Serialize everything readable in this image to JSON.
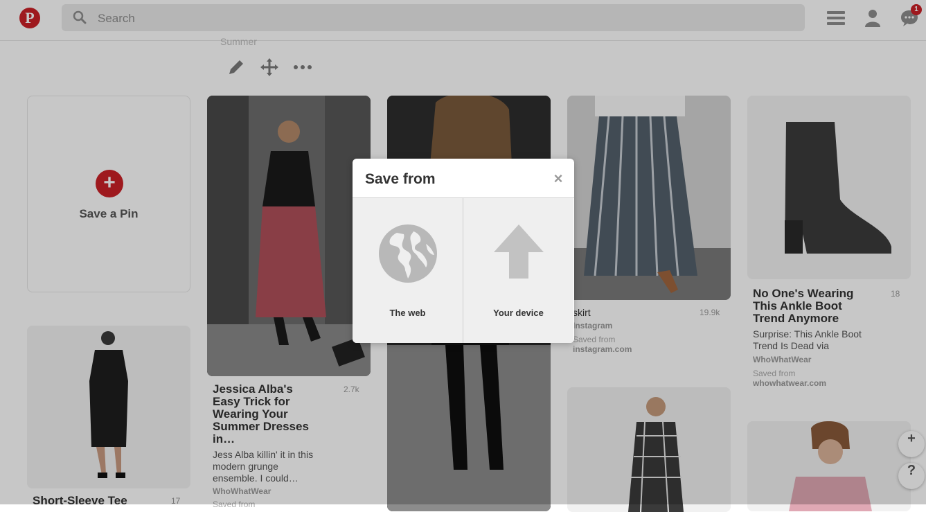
{
  "header": {
    "logo_letter": "P",
    "search_placeholder": "Search",
    "notification_count": "1"
  },
  "board": {
    "title": "Summer"
  },
  "save_pin": {
    "label": "Save a Pin"
  },
  "pins": [
    {
      "title": "Jessica Alba's Easy Trick for Wearing Your Summer Dresses in…",
      "description": "Jess Alba killin' it in this modern grunge ensemble. I could…",
      "source": "WhoWhatWear",
      "saved_prefix": "Saved from",
      "count": "2.7k"
    },
    {
      "title": "skirt",
      "source": "Instagram",
      "saved_prefix": "Saved from",
      "saved_domain": "instagram.com",
      "count": "19.9k"
    },
    {
      "title": "No One's Wearing This Ankle Boot Trend Anymore",
      "description": "Surprise: This Ankle Boot Trend Is Dead via",
      "source": "WhoWhatWear",
      "saved_prefix": "Saved from",
      "saved_domain": "whowhatwear.com",
      "count": "18"
    },
    {
      "title": "Short-Sleeve Tee",
      "count": "17"
    }
  ],
  "fab": {
    "add": "+",
    "help": "?"
  },
  "modal": {
    "title": "Save from",
    "close": "×",
    "options": [
      {
        "label": "The web",
        "icon": "globe-icon"
      },
      {
        "label": "Your device",
        "icon": "upload-arrow-icon"
      }
    ]
  },
  "colors": {
    "brand": "#cb2027"
  }
}
